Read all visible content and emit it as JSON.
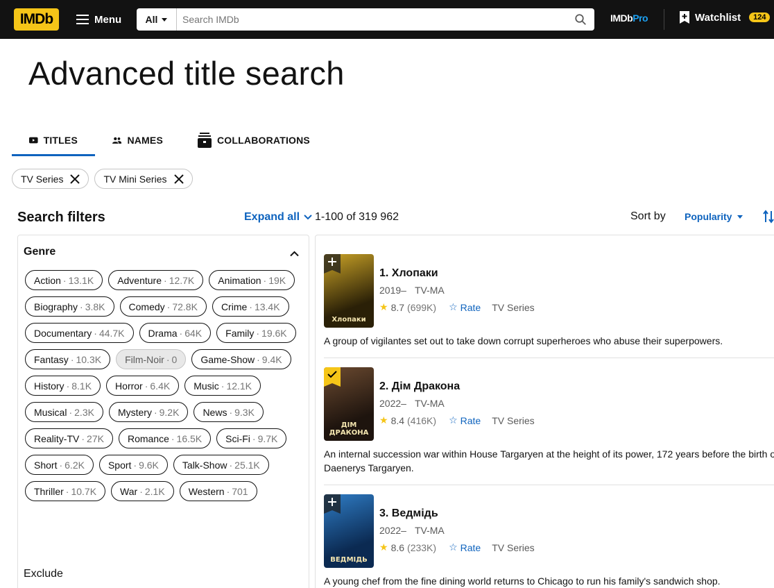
{
  "header": {
    "logo": "IMDb",
    "menu_label": "Menu",
    "search_scope": "All",
    "search_placeholder": "Search IMDb",
    "search_value": "",
    "imdbpro_a": "IMDb",
    "imdbpro_b": "Pro",
    "watchlist_label": "Watchlist",
    "watchlist_count": "124"
  },
  "page": {
    "title": "Advanced title search"
  },
  "tabs": [
    {
      "label": "TITLES",
      "icon": "video-icon",
      "active": true
    },
    {
      "label": "NAMES",
      "icon": "people-icon",
      "active": false
    },
    {
      "label": "COLLABORATIONS",
      "icon": "collaborations-icon",
      "active": false
    }
  ],
  "selected_filters": [
    "TV Series",
    "TV Mini Series"
  ],
  "filters": {
    "title": "Search filters",
    "expand_all": "Expand all",
    "genre_label": "Genre",
    "exclude_label": "Exclude",
    "genres": [
      {
        "name": "Action",
        "count": "13.1K"
      },
      {
        "name": "Adventure",
        "count": "12.7K"
      },
      {
        "name": "Animation",
        "count": "19K"
      },
      {
        "name": "Biography",
        "count": "3.8K"
      },
      {
        "name": "Comedy",
        "count": "72.8K"
      },
      {
        "name": "Crime",
        "count": "13.4K"
      },
      {
        "name": "Documentary",
        "count": "44.7K"
      },
      {
        "name": "Drama",
        "count": "64K"
      },
      {
        "name": "Family",
        "count": "19.6K"
      },
      {
        "name": "Fantasy",
        "count": "10.3K"
      },
      {
        "name": "Film-Noir",
        "count": "0",
        "disabled": true
      },
      {
        "name": "Game-Show",
        "count": "9.4K"
      },
      {
        "name": "History",
        "count": "8.1K"
      },
      {
        "name": "Horror",
        "count": "6.4K"
      },
      {
        "name": "Music",
        "count": "12.1K"
      },
      {
        "name": "Musical",
        "count": "2.3K"
      },
      {
        "name": "Mystery",
        "count": "9.2K"
      },
      {
        "name": "News",
        "count": "9.3K"
      },
      {
        "name": "Reality-TV",
        "count": "27K"
      },
      {
        "name": "Romance",
        "count": "16.5K"
      },
      {
        "name": "Sci-Fi",
        "count": "9.7K"
      },
      {
        "name": "Short",
        "count": "6.2K"
      },
      {
        "name": "Sport",
        "count": "9.6K"
      },
      {
        "name": "Talk-Show",
        "count": "25.1K"
      },
      {
        "name": "Thriller",
        "count": "10.7K"
      },
      {
        "name": "War",
        "count": "2.1K"
      },
      {
        "name": "Western",
        "count": "701"
      }
    ]
  },
  "results": {
    "count_text": "1-100 of 319 962",
    "sort_label": "Sort by",
    "sort_value": "Popularity",
    "items": [
      {
        "title": "1. Хлопаки",
        "year": "2019–",
        "cert": "TV-MA",
        "rating": "8.7",
        "votes": "(699K)",
        "rate_label": "Rate",
        "type": "TV Series",
        "plot": "A group of vigilantes set out to take down corrupt superheroes who abuse their superpowers.",
        "in_watchlist": false,
        "poster_text": "Хлопаки",
        "poster_colors": [
          "#2a2007",
          "#c9a227"
        ]
      },
      {
        "title": "2. Дім Дракона",
        "year": "2022–",
        "cert": "TV-MA",
        "rating": "8.4",
        "votes": "(416K)",
        "rate_label": "Rate",
        "type": "TV Series",
        "plot": "An internal succession war within House Targaryen at the height of its power, 172 years before the birth of Daenerys Targaryen.",
        "in_watchlist": true,
        "poster_text": "ДІМ ДРАКОНА",
        "poster_colors": [
          "#1e140e",
          "#6b4a30"
        ]
      },
      {
        "title": "3. Ведмідь",
        "year": "2022–",
        "cert": "TV-MA",
        "rating": "8.6",
        "votes": "(233K)",
        "rate_label": "Rate",
        "type": "TV Series",
        "plot": "A young chef from the fine dining world returns to Chicago to run his family's sandwich shop.",
        "in_watchlist": false,
        "poster_text": "ВЕДМІДЬ",
        "poster_colors": [
          "#0b2a52",
          "#2f7cc4"
        ]
      }
    ]
  },
  "colors": {
    "accent": "#0e63be",
    "brand": "#f5c518",
    "header_bg": "#121212"
  }
}
